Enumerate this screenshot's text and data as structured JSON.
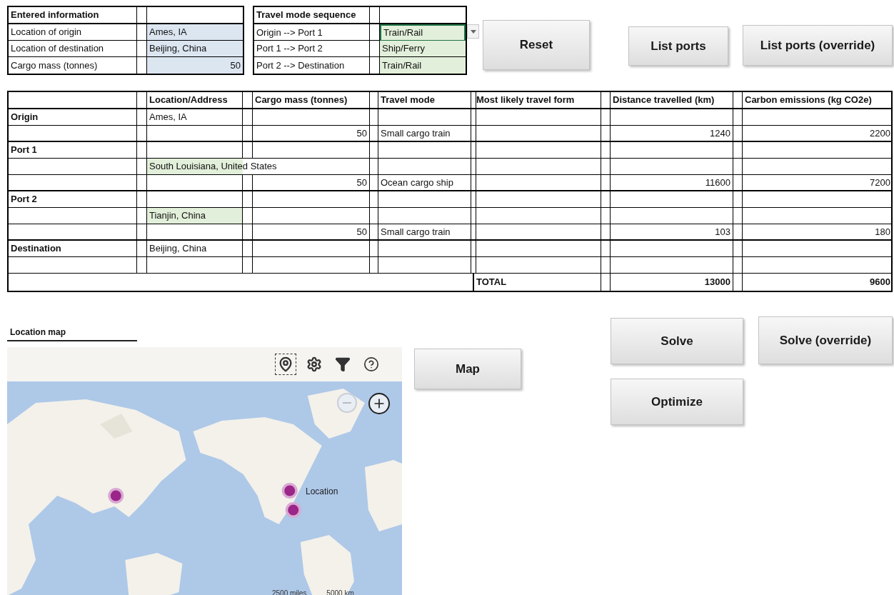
{
  "entered_information": {
    "title": "Entered information",
    "rows": [
      {
        "label": "Location of origin",
        "value": "Ames, IA",
        "kind": "text"
      },
      {
        "label": "Location of destination",
        "value": "Beijing, China",
        "kind": "text"
      },
      {
        "label": "Cargo mass (tonnes)",
        "value": "50",
        "kind": "number"
      }
    ]
  },
  "travel_mode_sequence": {
    "title": "Travel mode sequence",
    "rows": [
      {
        "label": "Origin --> Port 1",
        "value": "Train/Rail",
        "selected": true
      },
      {
        "label": "Port 1 --> Port 2",
        "value": "Ship/Ferry",
        "selected": false
      },
      {
        "label": "Port 2 --> Destination",
        "value": "Train/Rail",
        "selected": false
      }
    ]
  },
  "buttons": [
    {
      "label": "Reset"
    },
    {
      "label": "List ports"
    },
    {
      "label": "List ports (override)"
    },
    {
      "label": "Map"
    },
    {
      "label": "Solve"
    },
    {
      "label": "Solve (override)"
    },
    {
      "label": "Optimize"
    }
  ],
  "results_table": {
    "columns": [
      "Location/Address",
      "Cargo mass (tonnes)",
      "Travel mode",
      "Most likely travel form",
      "Distance travelled (km)",
      "Carbon emissions (kg CO2e)"
    ],
    "rows": [
      {
        "stage": "Origin",
        "location": "Ames, IA"
      },
      {
        "cargo_mass": "50",
        "travel_mode": "Small cargo train",
        "distance": "1240",
        "emissions": "2200"
      },
      {
        "stage": "Port 1"
      },
      {
        "location": "South Louisiana, United States",
        "highlighted": true,
        "spills": true
      },
      {
        "cargo_mass": "50",
        "travel_mode": "Ocean cargo ship",
        "distance": "11600",
        "emissions": "7200"
      },
      {
        "stage": "Port 2"
      },
      {
        "location": "Tianjin, China",
        "highlighted": true,
        "spills": false
      },
      {
        "cargo_mass": "50",
        "travel_mode": "Small cargo train",
        "distance": "103",
        "emissions": "180"
      },
      {
        "stage": "Destination",
        "location": "Beijing, China"
      },
      {}
    ],
    "total": {
      "label": "TOTAL",
      "distance": "13000",
      "emissions": "9600"
    }
  },
  "location_map": {
    "title": "Location map",
    "tools": [
      {
        "kind": "pin",
        "selected": true
      },
      {
        "kind": "settings",
        "selected": false
      },
      {
        "kind": "filter",
        "selected": false
      },
      {
        "kind": "help",
        "selected": false
      }
    ],
    "zoom_out": {
      "disabled": true
    },
    "zoom_in": {
      "disabled": false
    },
    "legend_label": "Location",
    "scale": [
      "2500 miles",
      "5000 km"
    ]
  }
}
